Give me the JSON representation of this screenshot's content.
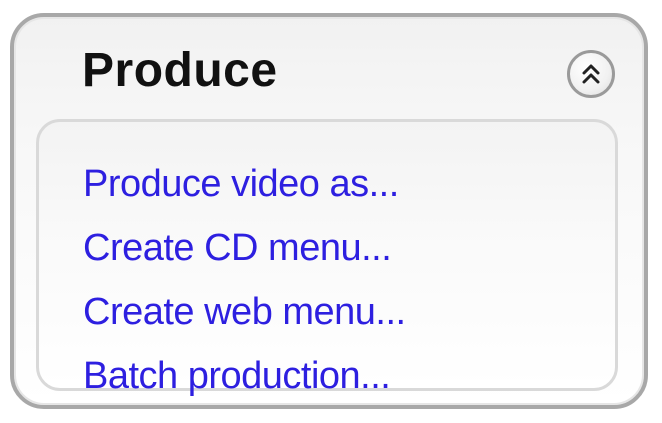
{
  "panel": {
    "title": "Produce",
    "collapse_icon": "double-chevron-up-icon",
    "links": [
      {
        "label": "Produce video as..."
      },
      {
        "label": "Create CD menu..."
      },
      {
        "label": "Create web menu..."
      },
      {
        "label": "Batch production..."
      }
    ]
  },
  "colors": {
    "link": "#2d1fe0",
    "title": "#111111",
    "border": "#a8a8a8"
  }
}
